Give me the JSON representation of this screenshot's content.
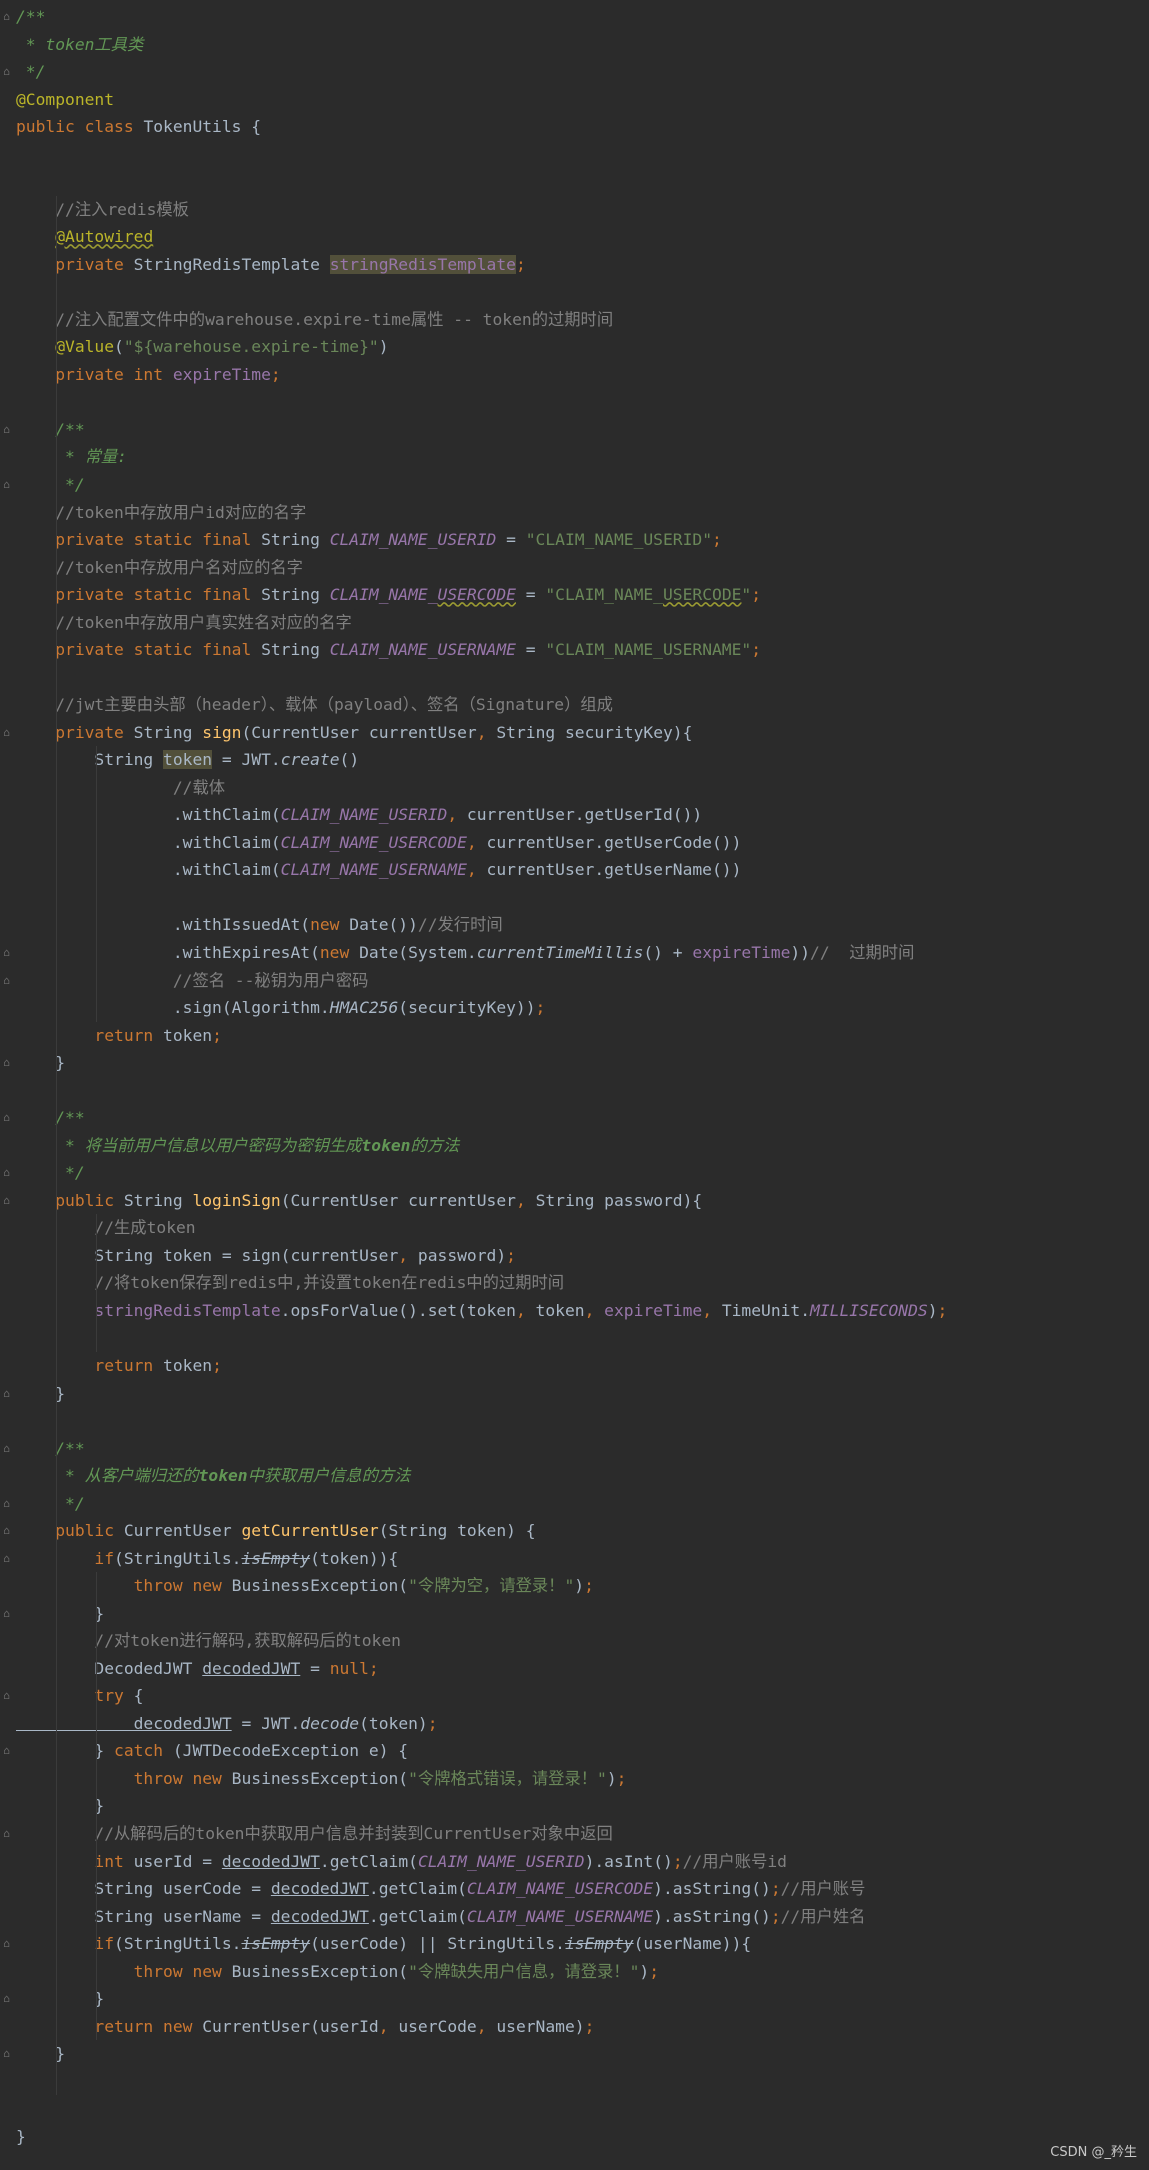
{
  "editor": {
    "language": "java",
    "lines": [
      [
        [
          "d",
          "/**"
        ]
      ],
      [
        [
          "d",
          " * token工具类"
        ]
      ],
      [
        [
          "d",
          " */"
        ]
      ],
      [
        [
          "a",
          "@Component"
        ]
      ],
      [
        [
          "k",
          "public class "
        ],
        [
          "",
          "TokenUtils {"
        ]
      ],
      [],
      [],
      [
        [
          "c",
          "    //注入redis模板"
        ]
      ],
      [
        [
          "",
          "    "
        ],
        [
          "a w",
          "@Autowired"
        ]
      ],
      [
        [
          "k",
          "    private "
        ],
        [
          "",
          "StringRedisTemplate "
        ],
        [
          "f hl",
          "stringRedisTemplate"
        ],
        [
          "k",
          ";"
        ]
      ],
      [],
      [
        [
          "c",
          "    //注入配置文件中的warehouse.expire-time属性 -- token的过期时间"
        ]
      ],
      [
        [
          "a",
          "    @Value"
        ],
        [
          "",
          "("
        ],
        [
          "s",
          "\"${warehouse.expire-time}\""
        ],
        [
          "",
          ")"
        ]
      ],
      [
        [
          "k",
          "    private int "
        ],
        [
          "f",
          "expireTime"
        ],
        [
          "k",
          ";"
        ]
      ],
      [],
      [
        [
          "d",
          "    /**"
        ]
      ],
      [
        [
          "d",
          "     * 常量:"
        ]
      ],
      [
        [
          "d",
          "     */"
        ]
      ],
      [
        [
          "c",
          "    //token中存放用户id对应的名字"
        ]
      ],
      [
        [
          "k",
          "    private static final "
        ],
        [
          "",
          "String "
        ],
        [
          "fi",
          "CLAIM_NAME_USERID"
        ],
        [
          "",
          " = "
        ],
        [
          "s",
          "\"CLAIM_NAME_USERID\""
        ],
        [
          "k",
          ";"
        ]
      ],
      [
        [
          "c",
          "    //token中存放用户名对应的名字"
        ]
      ],
      [
        [
          "k",
          "    private static final "
        ],
        [
          "",
          "String "
        ],
        [
          "fi",
          "CLAIM_NAME_"
        ],
        [
          "fi w",
          "USERCODE"
        ],
        [
          "",
          " = "
        ],
        [
          "s",
          "\"CLAIM_NAME_"
        ],
        [
          "s w",
          "USERCODE"
        ],
        [
          "s",
          "\""
        ],
        [
          "k",
          ";"
        ]
      ],
      [
        [
          "c",
          "    //token中存放用户真实姓名对应的名字"
        ]
      ],
      [
        [
          "k",
          "    private static final "
        ],
        [
          "",
          "String "
        ],
        [
          "fi",
          "CLAIM_NAME_USERNAME"
        ],
        [
          "",
          " = "
        ],
        [
          "s",
          "\"CLAIM_NAME_USERNAME\""
        ],
        [
          "k",
          ";"
        ]
      ],
      [],
      [
        [
          "c",
          "    //jwt主要由头部（header）、载体（payload）、签名（Signature）组成"
        ]
      ],
      [
        [
          "k",
          "    private "
        ],
        [
          "",
          "String "
        ],
        [
          "m",
          "sign"
        ],
        [
          "",
          "(CurrentUser currentUser"
        ],
        [
          "k",
          ", "
        ],
        [
          "",
          "String securityKey){"
        ]
      ],
      [
        [
          "",
          "        String "
        ],
        [
          "hl",
          "token"
        ],
        [
          "",
          " = JWT."
        ],
        [
          "it",
          "create"
        ],
        [
          "",
          "()"
        ]
      ],
      [
        [
          "c",
          "                //载体"
        ]
      ],
      [
        [
          "",
          "                .withClaim("
        ],
        [
          "fi",
          "CLAIM_NAME_USERID"
        ],
        [
          "k",
          ", "
        ],
        [
          "",
          "currentUser.getUserId())"
        ]
      ],
      [
        [
          "",
          "                .withClaim("
        ],
        [
          "fi",
          "CLAIM_NAME_USERCODE"
        ],
        [
          "k",
          ", "
        ],
        [
          "",
          "currentUser.getUserCode())"
        ]
      ],
      [
        [
          "",
          "                .withClaim("
        ],
        [
          "fi",
          "CLAIM_NAME_USERNAME"
        ],
        [
          "k",
          ", "
        ],
        [
          "",
          "currentUser.getUserName())"
        ]
      ],
      [],
      [
        [
          "",
          "                .withIssuedAt("
        ],
        [
          "k",
          "new "
        ],
        [
          "",
          "Date())"
        ],
        [
          "c",
          "//发行时间"
        ]
      ],
      [
        [
          "",
          "                .withExpiresAt("
        ],
        [
          "k",
          "new "
        ],
        [
          "",
          "Date(System."
        ],
        [
          "it",
          "currentTimeMillis"
        ],
        [
          "",
          "() + "
        ],
        [
          "f",
          "expireTime"
        ],
        [
          "",
          "))"
        ],
        [
          "c",
          "//  过期时间"
        ]
      ],
      [
        [
          "c",
          "                //签名 --秘钥为用户密码"
        ]
      ],
      [
        [
          "",
          "                .sign(Algorithm."
        ],
        [
          "it",
          "HMAC256"
        ],
        [
          "",
          "(securityKey))"
        ],
        [
          "k",
          ";"
        ]
      ],
      [
        [
          "k",
          "        return "
        ],
        [
          "",
          "token"
        ],
        [
          "k",
          ";"
        ]
      ],
      [
        [
          "",
          "    }"
        ]
      ],
      [],
      [
        [
          "d",
          "    /**"
        ]
      ],
      [
        [
          "d",
          "     * 将当前用户信息以用户密码为密钥生成"
        ],
        [
          "d dt",
          "token"
        ],
        [
          "d",
          "的方法"
        ]
      ],
      [
        [
          "d",
          "     */"
        ]
      ],
      [
        [
          "k",
          "    public "
        ],
        [
          "",
          "String "
        ],
        [
          "m",
          "loginSign"
        ],
        [
          "",
          "(CurrentUser currentUser"
        ],
        [
          "k",
          ", "
        ],
        [
          "",
          "String password){"
        ]
      ],
      [
        [
          "c",
          "        //生成token"
        ]
      ],
      [
        [
          "",
          "        String token = sign(currentUser"
        ],
        [
          "k",
          ", "
        ],
        [
          "",
          "password)"
        ],
        [
          "k",
          ";"
        ]
      ],
      [
        [
          "c",
          "        //将token保存到redis中,并设置token在redis中的过期时间"
        ]
      ],
      [
        [
          "f",
          "        stringRedisTemplate"
        ],
        [
          "",
          ".opsForValue().set(token"
        ],
        [
          "k",
          ", "
        ],
        [
          "",
          "token"
        ],
        [
          "k",
          ", "
        ],
        [
          "f",
          "expireTime"
        ],
        [
          "k",
          ", "
        ],
        [
          "",
          "TimeUnit."
        ],
        [
          "fi",
          "MILLISECONDS"
        ],
        [
          "",
          ")"
        ],
        [
          "k",
          ";"
        ]
      ],
      [],
      [
        [
          "k",
          "        return "
        ],
        [
          "",
          "token"
        ],
        [
          "k",
          ";"
        ]
      ],
      [
        [
          "",
          "    }"
        ]
      ],
      [],
      [
        [
          "d",
          "    /**"
        ]
      ],
      [
        [
          "d",
          "     * 从客户端归还的"
        ],
        [
          "d dt",
          "token"
        ],
        [
          "d",
          "中获取用户信息的方法"
        ]
      ],
      [
        [
          "d",
          "     */"
        ]
      ],
      [
        [
          "k",
          "    public "
        ],
        [
          "",
          "CurrentUser "
        ],
        [
          "m",
          "getCurrentUser"
        ],
        [
          "",
          "(String token) {"
        ]
      ],
      [
        [
          "k",
          "        if"
        ],
        [
          "",
          "(StringUtils."
        ],
        [
          "dep",
          "isEmpty"
        ],
        [
          "",
          "(token)){"
        ]
      ],
      [
        [
          "k",
          "            throw new "
        ],
        [
          "",
          "BusinessException("
        ],
        [
          "s",
          "\"令牌为空，请登录！\""
        ],
        [
          "",
          ")"
        ],
        [
          "k",
          ";"
        ]
      ],
      [
        [
          "",
          "        }"
        ]
      ],
      [
        [
          "c",
          "        //对token进行解码,获取解码后的token"
        ]
      ],
      [
        [
          "",
          "        DecodedJWT "
        ],
        [
          "u",
          "decodedJWT"
        ],
        [
          "",
          " = "
        ],
        [
          "k",
          "null;"
        ]
      ],
      [
        [
          "k",
          "        try "
        ],
        [
          "",
          "{"
        ]
      ],
      [
        [
          "u",
          "            decodedJWT"
        ],
        [
          "",
          " = JWT."
        ],
        [
          "it",
          "decode"
        ],
        [
          "",
          "(token)"
        ],
        [
          "k",
          ";"
        ]
      ],
      [
        [
          "",
          "        } "
        ],
        [
          "k",
          "catch "
        ],
        [
          "",
          "(JWTDecodeException e) {"
        ]
      ],
      [
        [
          "k",
          "            throw new "
        ],
        [
          "",
          "BusinessException("
        ],
        [
          "s",
          "\"令牌格式错误，请登录！\""
        ],
        [
          "",
          ")"
        ],
        [
          "k",
          ";"
        ]
      ],
      [
        [
          "",
          "        }"
        ]
      ],
      [
        [
          "c",
          "        //从解码后的token中获取用户信息并封装到CurrentUser对象中返回"
        ]
      ],
      [
        [
          "k",
          "        int "
        ],
        [
          "",
          "userId = "
        ],
        [
          "u",
          "decodedJWT"
        ],
        [
          "",
          ".getClaim("
        ],
        [
          "fi",
          "CLAIM_NAME_USERID"
        ],
        [
          "",
          ").asInt()"
        ],
        [
          "k",
          ";"
        ],
        [
          "c",
          "//用户账号id"
        ]
      ],
      [
        [
          "",
          "        String userCode = "
        ],
        [
          "u",
          "decodedJWT"
        ],
        [
          "",
          ".getClaim("
        ],
        [
          "fi",
          "CLAIM_NAME_USERCODE"
        ],
        [
          "",
          ").asString()"
        ],
        [
          "k",
          ";"
        ],
        [
          "c",
          "//用户账号"
        ]
      ],
      [
        [
          "",
          "        String userName = "
        ],
        [
          "u",
          "decodedJWT"
        ],
        [
          "",
          ".getClaim("
        ],
        [
          "fi",
          "CLAIM_NAME_USERNAME"
        ],
        [
          "",
          ").asString()"
        ],
        [
          "k",
          ";"
        ],
        [
          "c",
          "//用户姓名"
        ]
      ],
      [
        [
          "k",
          "        if"
        ],
        [
          "",
          "(StringUtils."
        ],
        [
          "dep",
          "isEmpty"
        ],
        [
          "",
          "(userCode) || StringUtils."
        ],
        [
          "dep",
          "isEmpty"
        ],
        [
          "",
          "(userName)){"
        ]
      ],
      [
        [
          "k",
          "            throw new "
        ],
        [
          "",
          "BusinessException("
        ],
        [
          "s",
          "\"令牌缺失用户信息，请登录！\""
        ],
        [
          "",
          ")"
        ],
        [
          "k",
          ";"
        ]
      ],
      [
        [
          "",
          "        }"
        ]
      ],
      [
        [
          "k",
          "        return new "
        ],
        [
          "",
          "CurrentUser(userId"
        ],
        [
          "k",
          ", "
        ],
        [
          "",
          "userCode"
        ],
        [
          "k",
          ", "
        ],
        [
          "",
          "userName)"
        ],
        [
          "k",
          ";"
        ]
      ],
      [
        [
          "",
          "    }"
        ]
      ],
      [],
      [],
      [
        [
          "",
          "}"
        ]
      ]
    ]
  },
  "watermark": "CSDN @_矜生"
}
